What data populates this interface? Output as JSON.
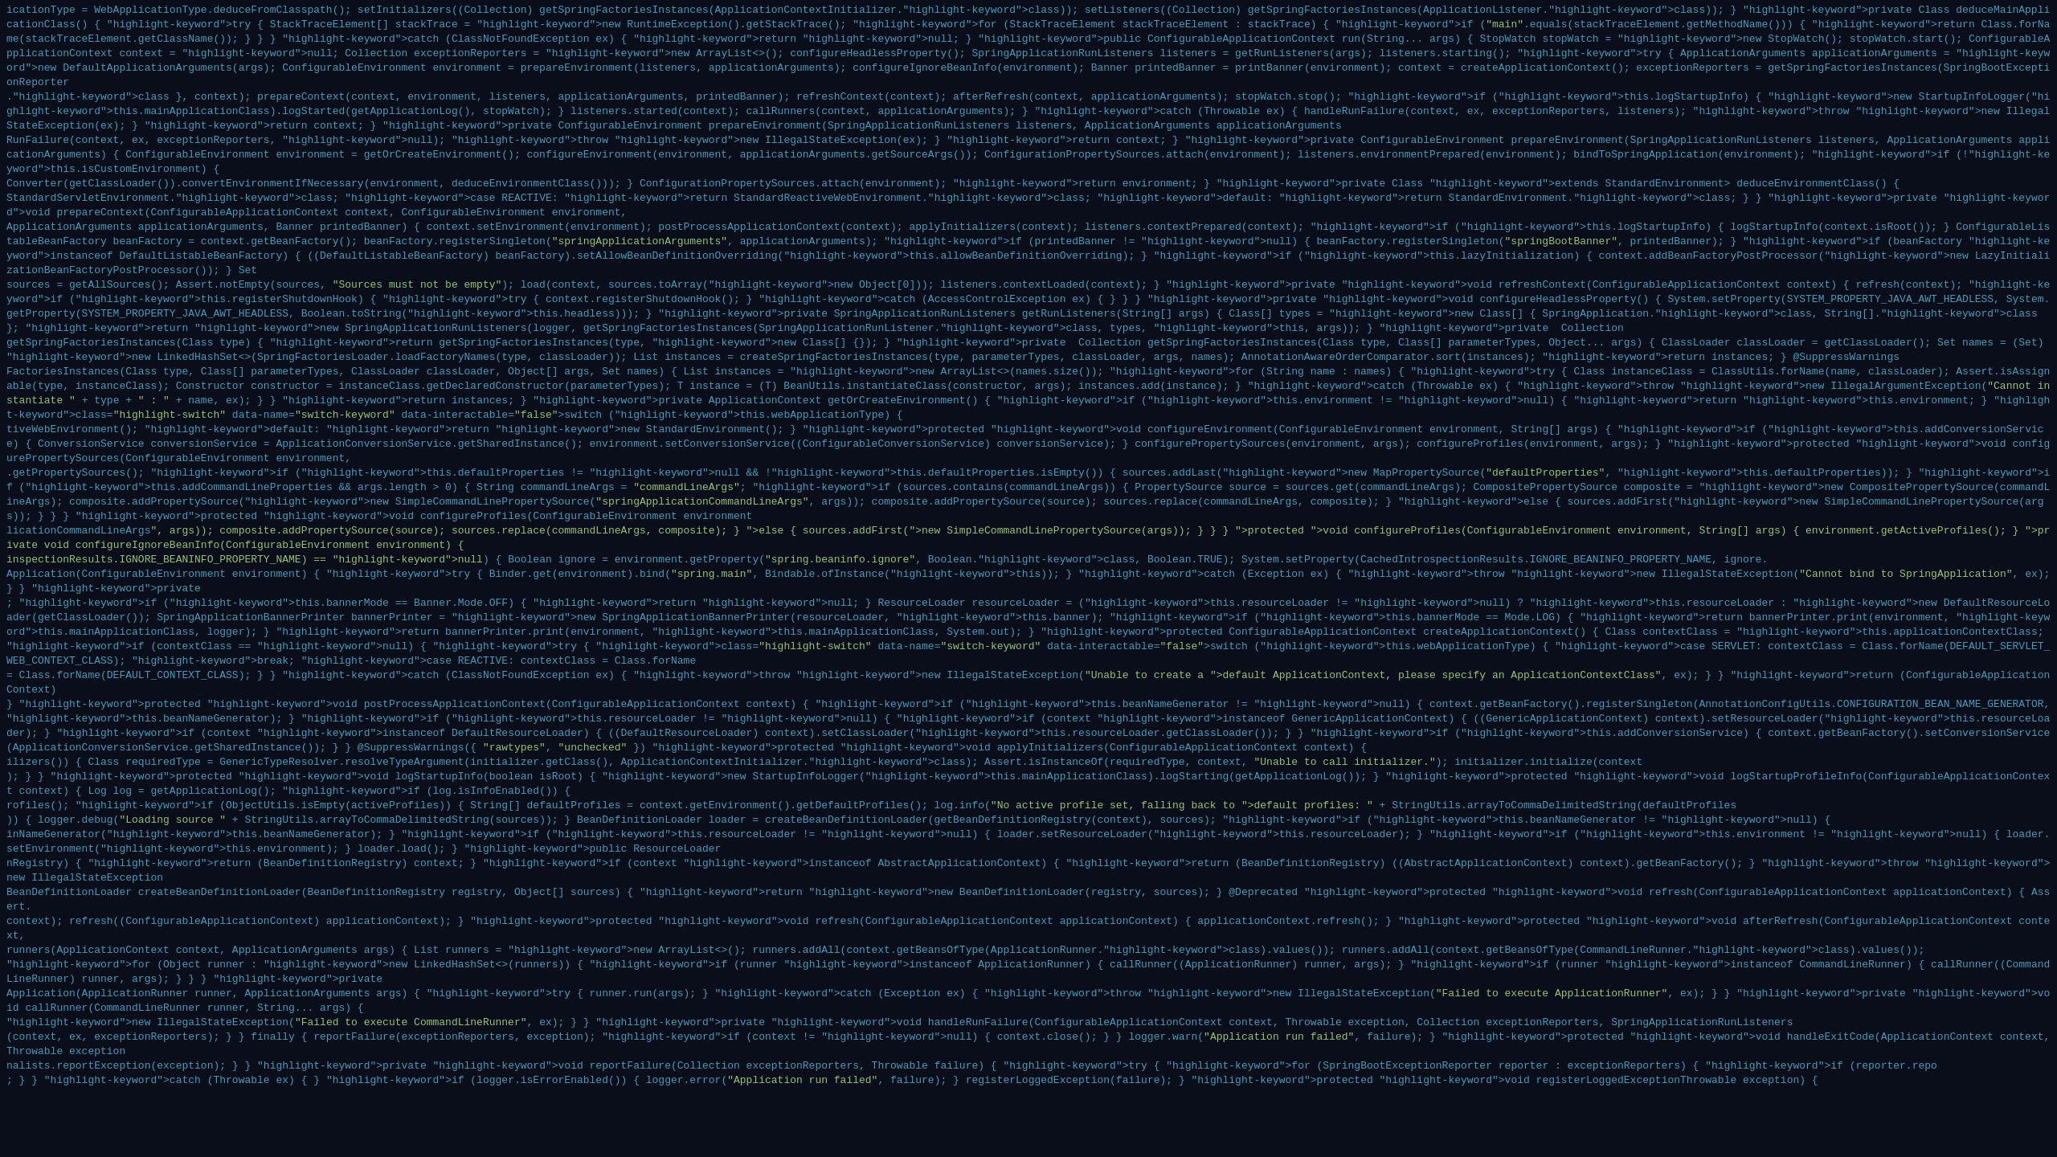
{
  "editor": {
    "background_color": "#0a0e1a",
    "text_color": "#4a9aba",
    "font_size": "13px",
    "line_height": "18px"
  },
  "code": {
    "lines": [
      "icationType = WebApplicationType.deduceFromClasspath(); setInitializers((Collection) getSpringFactoriesInstances(ApplicationContextInitializer.class)); setListeners((Collection) getSpringFactoriesInstances(ApplicationListener.class)); } private Class<?> deduceMainApplicationClass() { try { StackTraceElement[] stackTrace = new RuntimeException().getStackTrace(); for (StackTraceElement stackTraceElement : stackTrace) { if (\"main\".equals(stackTraceElement.getMethodName())) { return Class.forName(stackTraceElement.getClassName()); } } } catch (ClassNotFoundException ex) { return null; } public ConfigurableApplicationContext run(String... args) { StopWatch stopWatch = new StopWatch(); stopWatch.start(); ConfigurableApplicationContext context = null; Collection<SpringBootExceptionReporter> exceptionReporters = new ArrayList<>(); configureHeadlessProperty(); SpringApplicationRunListeners listeners = getRunListeners(args); listeners.starting(); try { ApplicationArguments applicationArguments = new DefaultApplicationArguments(args); ConfigurableEnvironment environment = prepareEnvironment(listeners, applicationArguments); configureIgnoreBeanInfo(environment); Banner printedBanner = printBanner(environment); context = createApplicationContext(); exceptionReporters = getSpringFactoriesInstances(SpringBootExceptionReporter",
      ".class }, context); prepareContext(context, environment, listeners, applicationArguments, printedBanner); refreshContext(context); afterRefresh(context, applicationArguments); stopWatch.stop(); if (this.logStartupInfo) { new StartupInfoLogger(this.mainApplicationClass).logStarted(getApplicationLog(), stopWatch); } listeners.started(context); callRunners(context, applicationArguments); } catch (Throwable ex) { handleRunFailure(context, ex, exceptionReporters, listeners); throw new IllegalStateException(ex); } return context; } private ConfigurableEnvironment prepareEnvironment(SpringApplicationRunListeners listeners, ApplicationArguments applicationArguments",
      "RunFailure(context, ex, exceptionReporters, null); throw new IllegalStateException(ex); } return context; } private ConfigurableEnvironment prepareEnvironment(SpringApplicationRunListeners listeners, ApplicationArguments applicationArguments) { ConfigurableEnvironment environment = getOrCreateEnvironment(); configureEnvironment(environment, applicationArguments.getSourceArgs()); ConfigurationPropertySources.attach(environment); listeners.environmentPrepared(environment); bindToSpringApplication(environment); if (!this.isCustomEnvironment) {",
      "Converter(getClassLoader()).convertEnvironmentIfNecessary(environment, deduceEnvironmentClass())); } ConfigurationPropertySources.attach(environment); return environment; } private Class<?> extends StandardEnvironment> deduceEnvironmentClass() {",
      "StandardServletEnvironment.class; case REACTIVE: return StandardReactiveWebEnvironment.class; default: return StandardEnvironment.class; } } private void prepareContext(ConfigurableApplicationContext context, ConfigurableEnvironment environment,",
      "ApplicationArguments applicationArguments, Banner printedBanner) { context.setEnvironment(environment); postProcessApplicationContext(context); applyInitializers(context); listeners.contextPrepared(context); if (this.logStartupInfo) { logStartupInfo(context.isRoot()); } ConfigurableListableBeanFactory beanFactory = context.getBeanFactory(); beanFactory.registerSingleton(\"springApplicationArguments\", applicationArguments); if (printedBanner != null) { beanFactory.registerSingleton(\"springBootBanner\", printedBanner); } if (beanFactory instanceof DefaultListableBeanFactory) { ((DefaultListableBeanFactory) beanFactory).setAllowBeanDefinitionOverriding(this.allowBeanDefinitionOverriding); } if (this.lazyInitialization) { context.addBeanFactoryPostProcessor(new LazyInitializationBeanFactoryPostProcessor()); } Set<Object>",
      "sources = getAllSources(); Assert.notEmpty(sources, \"Sources must not be empty\"); load(context, sources.toArray(new Object[0])); listeners.contextLoaded(context); } private void refreshContext(ConfigurableApplicationContext context) { refresh(context); if (this.registerShutdownHook) { try { context.registerShutdownHook(); } catch (AccessControlException ex) { } } } private void configureHeadlessProperty() { System.setProperty(SYSTEM_PROPERTY_JAVA_AWT_HEADLESS, System.getProperty(SYSTEM_PROPERTY_JAVA_AWT_HEADLESS, Boolean.toString(this.headless))); } private SpringApplicationRunListeners getRunListeners(String[] args) { Class<?>[] types = new Class<?>[] { SpringApplication.class, String[].class }; return new SpringApplicationRunListeners(logger, getSpringFactoriesInstances(SpringApplicationRunListener.class, types, this, args)); } private <T> Collection<T>",
      "getSpringFactoriesInstances(Class<T> type) { return getSpringFactoriesInstances(type, new Class<?>[] {}); } private <T> Collection<T> getSpringFactoriesInstances(Class<T> type, Class<?>[] parameterTypes, Object... args) { ClassLoader classLoader = getClassLoader(); Set<String> names = (Set<String>) new LinkedHashSet<>(SpringFactoriesLoader.loadFactoryNames(type, classLoader)); List<T> instances = createSpringFactoriesInstances(type, parameterTypes, classLoader, args, names); AnnotationAwareOrderComparator.sort(instances); return instances; } @SuppressWarnings",
      "FactoriesInstances(Class<T> type, Class<?>[] parameterTypes, ClassLoader classLoader, Object[] args, Set<String> names) { List<T> instances = new ArrayList<>(names.size()); for (String name : names) { try { Class<?> instanceClass = ClassUtils.forName(name, classLoader); Assert.isAssignable(type, instanceClass); Constructor<?> constructor = instanceClass.getDeclaredConstructor(parameterTypes); T instance = (T) BeanUtils.instantiateClass(constructor, args); instances.add(instance); } catch (Throwable ex) { throw new IllegalArgumentException(\"Cannot instantiate \" + type + \" : \" + name, ex); } } return instances; } private ApplicationContext getOrCreateEnvironment() { if (this.environment != null) { return this.environment; } switch (this.webApplicationType) {",
      "tiveWebEnvironment(); default: return new StandardEnvironment(); } protected void configureEnvironment(ConfigurableEnvironment environment, String[] args) { if (this.addConversionService) { ConversionService conversionService = ApplicationConversionService.getSharedInstance(); environment.setConversionService((ConfigurableConversionService) conversionService); } configurePropertySources(environment, args); configureProfiles(environment, args); } protected void configurePropertySources(ConfigurableEnvironment environment,",
      ".getPropertySources(); if (this.defaultProperties != null && !this.defaultProperties.isEmpty()) { sources.addLast(new MapPropertySource(\"defaultProperties\", this.defaultProperties)); } if (this.addCommandLineProperties && args.length > 0) { String commandLineArgs = \"commandLineArgs\"; if (sources.contains(commandLineArgs)) { PropertySource<?> source = sources.get(commandLineArgs); CompositePropertySource composite = new CompositePropertySource(commandLineArgs); composite.addPropertySource(new SimpleCommandLinePropertySource(\"springApplicationCommandLineArgs\", args)); composite.addPropertySource(source); sources.replace(commandLineArgs, composite); } else { sources.addFirst(new SimpleCommandLinePropertySource(args)); } } } protected void configureProfiles(ConfigurableEnvironment environment",
      "licationCommandLineArgs\", args)); composite.addPropertySource(source); sources.replace(commandLineArgs, composite); } else { sources.addFirst(new SimpleCommandLinePropertySource(args)); } } } protected void configureProfiles(ConfigurableEnvironment environment, String[] args) { environment.getActiveProfiles(); } private void configureIgnoreBeanInfo(ConfigurableEnvironment environment) {",
      "inspectionResults.IGNORE_BEANINFO_PROPERTY_NAME) == null) { Boolean ignore = environment.getProperty(\"spring.beaninfo.ignore\", Boolean.class, Boolean.TRUE); System.setProperty(CachedIntrospectionResults.IGNORE_BEANINFO_PROPERTY_NAME, ignore.",
      "Application(ConfigurableEnvironment environment) { try { Binder.get(environment).bind(\"spring.main\", Bindable.ofInstance(this)); } catch (Exception ex) { throw new IllegalStateException(\"Cannot bind to SpringApplication\", ex); } } private",
      "; if (this.bannerMode == Banner.Mode.OFF) { return null; } ResourceLoader resourceLoader = (this.resourceLoader != null) ? this.resourceLoader : new DefaultResourceLoader(getClassLoader()); SpringApplicationBannerPrinter bannerPrinter = new SpringApplicationBannerPrinter(resourceLoader, this.banner); if (this.bannerMode == Mode.LOG) { return bannerPrinter.print(environment, this.mainApplicationClass, logger); } return bannerPrinter.print(environment, this.mainApplicationClass, System.out); } protected ConfigurableApplicationContext createApplicationContext() { Class<?> contextClass = this.applicationContextClass; if (contextClass == null) { try { switch (this.webApplicationType) { case SERVLET: contextClass = Class.forName(DEFAULT_SERVLET_WEB_CONTEXT_CLASS); break; case REACTIVE: contextClass = Class.forName",
      "= Class.forName(DEFAULT_CONTEXT_CLASS); } } catch (ClassNotFoundException ex) { throw new IllegalStateException(\"Unable to create a default ApplicationContext, please specify an ApplicationContextClass\", ex); } } return (ConfigurableApplicationContext)",
      "} protected void postProcessApplicationContext(ConfigurableApplicationContext context) { if (this.beanNameGenerator != null) { context.getBeanFactory().registerSingleton(AnnotationConfigUtils.CONFIGURATION_BEAN_NAME_GENERATOR, this.beanNameGenerator); } if (this.resourceLoader != null) { if (context instanceof GenericApplicationContext) { ((GenericApplicationContext) context).setResourceLoader(this.resourceLoader); } if (context instanceof DefaultResourceLoader) { ((DefaultResourceLoader) context).setClassLoader(this.resourceLoader.getClassLoader()); } } if (this.addConversionService) { context.getBeanFactory().setConversionService(ApplicationConversionService.getSharedInstance()); } } @SuppressWarnings({ \"rawtypes\", \"unchecked\" }) protected void applyInitializers(ConfigurableApplicationContext context) {",
      "ilizers()) { Class<?> requiredType = GenericTypeResolver.resolveTypeArgument(initializer.getClass(), ApplicationContextInitializer.class); Assert.isInstanceOf(requiredType, context, \"Unable to call initializer.\"); initializer.initialize(context",
      "); } } protected void logStartupInfo(boolean isRoot) { new StartupInfoLogger(this.mainApplicationClass).logStarting(getApplicationLog()); } protected void logStartupProfileInfo(ConfigurableApplicationContext context) { Log log = getApplicationLog(); if (log.isInfoEnabled()) {",
      "rofiles(); if (ObjectUtils.isEmpty(activeProfiles)) { String[] defaultProfiles = context.getEnvironment().getDefaultProfiles(); log.info(\"No active profile set, falling back to default profiles: \" + StringUtils.arrayToCommaDelimitedString(defaultProfiles",
      ")) { logger.debug(\"Loading source \" + StringUtils.arrayToCommaDelimitedString(sources)); } BeanDefinitionLoader loader = createBeanDefinitionLoader(getBeanDefinitionRegistry(context), sources); if (this.beanNameGenerator != null) {",
      "inNameGenerator(this.beanNameGenerator); } if (this.resourceLoader != null) { loader.setResourceLoader(this.resourceLoader); } if (this.environment != null) { loader.setEnvironment(this.environment); } loader.load(); } public ResourceLoader",
      "nRegistry) { return (BeanDefinitionRegistry) context; } if (context instanceof AbstractApplicationContext) { return (BeanDefinitionRegistry) ((AbstractApplicationContext) context).getBeanFactory(); } throw new IllegalStateException",
      "BeanDefinitionLoader createBeanDefinitionLoader(BeanDefinitionRegistry registry, Object[] sources) { return new BeanDefinitionLoader(registry, sources); } @Deprecated protected void refresh(ConfigurableApplicationContext applicationContext) { Assert.",
      "context); refresh((ConfigurableApplicationContext) applicationContext); } protected void refresh(ConfigurableApplicationContext applicationContext) { applicationContext.refresh(); } protected void afterRefresh(ConfigurableApplicationContext context,",
      "runners(ApplicationContext context, ApplicationArguments args) { List<Object> runners = new ArrayList<>(); runners.addAll(context.getBeansOfType(ApplicationRunner.class).values()); runners.addAll(context.getBeansOfType(CommandLineRunner.class).values());",
      "for (Object runner : new LinkedHashSet<>(runners)) { if (runner instanceof ApplicationRunner) { callRunner((ApplicationRunner) runner, args); } if (runner instanceof CommandLineRunner) { callRunner((CommandLineRunner) runner, args); } } } private",
      "Application(ApplicationRunner runner, ApplicationArguments args) { try { runner.run(args); } catch (Exception ex) { throw new IllegalStateException(\"Failed to execute ApplicationRunner\", ex); } } private void callRunner(CommandLineRunner runner, String... args) {",
      "new IllegalStateException(\"Failed to execute CommandLineRunner\", ex); } } private void handleRunFailure(ConfigurableApplicationContext context, Throwable exception, Collection<SpringBootExceptionReporter> exceptionReporters, SpringApplicationRunListeners",
      "(context, ex, exceptionReporters); } } finally { reportFailure(exceptionReporters, exception); if (context != null) { context.close(); } } logger.warn(\"Application run failed\", failure); } protected void handleExitCode(ApplicationContext context, Throwable exception",
      "nalists.reportException(exception); } } private void reportFailure(Collection<SpringBootExceptionReporter> exceptionReporters, Throwable failure) { try { for (SpringBootExceptionReporter reporter : exceptionReporters) { if (reporter.repo",
      "; } } catch (Throwable ex) { } if (logger.isErrorEnabled()) { logger.error(\"Application run failed\", failure); } registerLoggedException(failure); } protected void registerLoggedExceptionThrowable exception) {"
    ],
    "highlighted_word": "switch",
    "highlighted_line": 8,
    "highlighted_col_start": 1668,
    "highlighted_col_end": 1734
  }
}
